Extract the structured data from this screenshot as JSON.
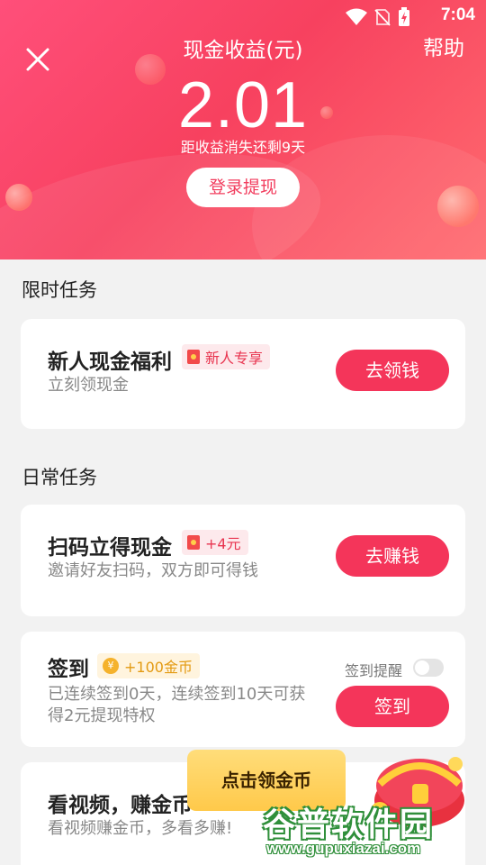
{
  "status_bar": {
    "time": "7:04",
    "icons": [
      "wifi-icon",
      "no-sim-icon",
      "battery-charging-icon"
    ]
  },
  "header": {
    "title": "现金收益(元)",
    "help_label": "帮助",
    "amount": "2.01",
    "expire_note": "距收益消失还剩9天",
    "login_withdraw_label": "登录提现",
    "close_icon": "close-icon",
    "colors": {
      "gradient_start": "#ff4f7a",
      "gradient_end": "#ff6b6f"
    }
  },
  "sections": {
    "limited": "限时任务",
    "daily": "日常任务"
  },
  "tasks": {
    "newbie": {
      "title": "新人现金福利",
      "tag": "新人专享",
      "subtitle": "立刻领现金",
      "button": "去领钱"
    },
    "scan": {
      "title": "扫码立得现金",
      "tag": "+4元",
      "subtitle": "邀请好友扫码，双方即可得钱",
      "button": "去赚钱"
    },
    "checkin": {
      "title": "签到",
      "tag": "+100金币",
      "coin_symbol": "¥",
      "subtitle_line1": "已连续签到0天，连续签到10天可获",
      "subtitle_line2": "得2元提现特权",
      "reminder_label": "签到提醒",
      "reminder_on": false,
      "button": "签到"
    },
    "video": {
      "title": "看视频，赚金币",
      "subtitle": "看视频赚金币，多看多赚!"
    }
  },
  "float_tip": {
    "label": "点击领金币"
  },
  "watermark": {
    "text": "谷普软件园",
    "url": "www.gupuxiazai.com"
  },
  "accent_color": "#f4355a"
}
